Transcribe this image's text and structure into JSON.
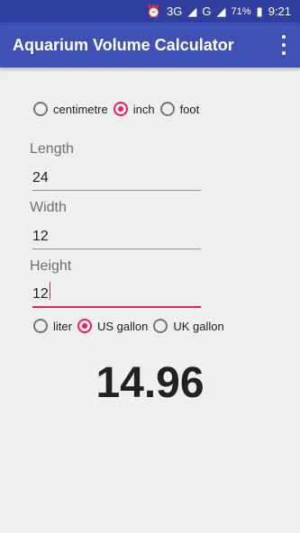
{
  "status": {
    "network": "3G",
    "network2": "G",
    "battery": "71%",
    "time": "9:21"
  },
  "app": {
    "title": "Aquarium Volume Calculator"
  },
  "units": {
    "length_options": [
      "centimetre",
      "inch",
      "foot"
    ],
    "length_selected": "inch",
    "volume_options": [
      "liter",
      "US gallon",
      "UK gallon"
    ],
    "volume_selected": "US gallon"
  },
  "fields": {
    "length": {
      "label": "Length",
      "value": "24"
    },
    "width": {
      "label": "Width",
      "value": "12"
    },
    "height": {
      "label": "Height",
      "value": "12"
    }
  },
  "result": "14.96"
}
